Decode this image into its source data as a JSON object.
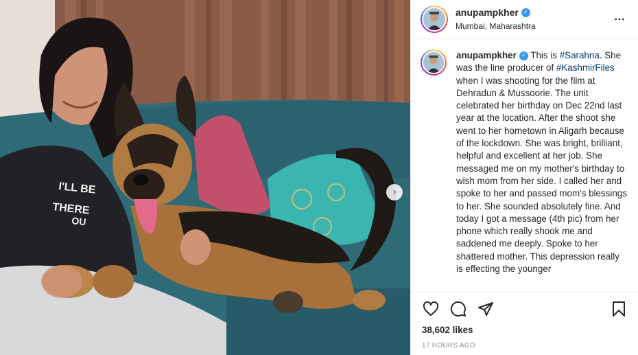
{
  "post": {
    "username": "anupampkher",
    "location": "Mumbai, Maharashtra",
    "more_icon": "⋯",
    "caption": {
      "username": "anupampkher",
      "text_1": " This is ",
      "hashtag_1": "#Sarahna",
      "text_2": ". She was the line producer of ",
      "hashtag_2": "#KashmirFiles",
      "text_3": " when I was shooting for the film at Dehradun & Mussoorie. The unit celebrated her birthday on Dec 22nd last year at the location. After the shoot she went to her hometown in Aligarh because of the lockdown. She was bright, brilliant, helpful and excellent at her job. She messaged me on my mother's birthday to wish mom from her side. I called her and spoke to her and passed mom's blessings to her. She sounded absolutely fine. And today I got a message (4th pic) from her phone which really shook me and saddened me deeply. Spoke to her shattered mother. This depression really is effecting the younger"
    },
    "likes": "38,602 likes",
    "time": "17 HOURS AGO",
    "photo_text": "I'LL BE THERE FOR YOU"
  },
  "icons": {
    "like": "heart-icon",
    "comment": "comment-icon",
    "share": "share-icon",
    "save": "bookmark-icon",
    "next": "chevron-right-icon",
    "verified": "verified-badge-icon"
  },
  "colors": {
    "verified": "#3897f0",
    "hashtag": "#00376b",
    "muted": "#8e8e8e"
  }
}
